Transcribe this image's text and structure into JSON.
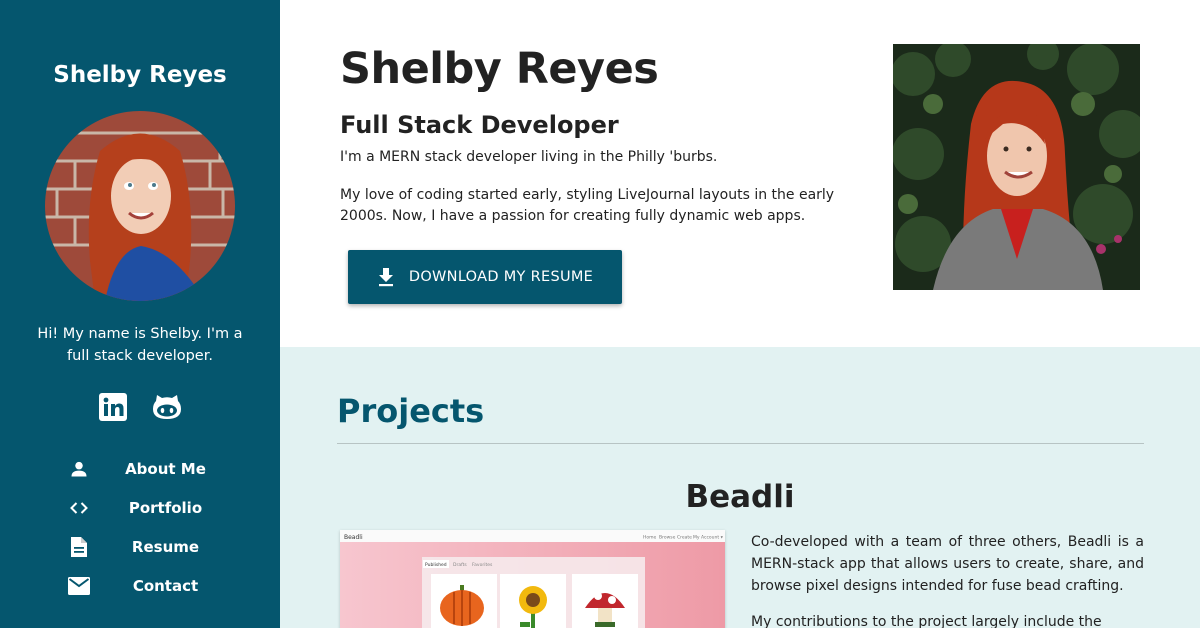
{
  "sidebar": {
    "name": "Shelby Reyes",
    "bio": "Hi! My name is Shelby. I'm a full stack developer.",
    "social": [
      {
        "icon": "linkedin-icon"
      },
      {
        "icon": "github-icon"
      }
    ],
    "nav": [
      {
        "label": "About Me",
        "icon": "person-icon"
      },
      {
        "label": "Portfolio",
        "icon": "code-icon"
      },
      {
        "label": "Resume",
        "icon": "document-icon"
      },
      {
        "label": "Contact",
        "icon": "mail-icon"
      }
    ],
    "bg_color": "#05566e"
  },
  "hero": {
    "name": "Shelby Reyes",
    "role": "Full Stack Developer",
    "p1": "I'm a MERN stack developer living in the Philly 'burbs.",
    "p2": "My love of coding started early, styling LiveJournal layouts in the early 2000s. Now, I have a passion for creating fully dynamic web apps.",
    "button_label": "DOWNLOAD MY RESUME",
    "button_icon": "download-icon"
  },
  "projects": {
    "heading": "Projects",
    "items": [
      {
        "title": "Beadli",
        "screenshot": {
          "brand": "Beadli",
          "nav": [
            "Home",
            "Browse",
            "Create",
            "My Account ▾"
          ],
          "tabs": [
            "Published",
            "Drafts",
            "Favorites"
          ]
        },
        "paragraphs": [
          "Co-developed with a team of three others, Beadli is a MERN-stack app that allows users to create, share, and browse pixel designs intended for fuse bead crafting.",
          "My contributions to the project largely include the"
        ]
      }
    ],
    "bg_color": "#e2f2f2"
  }
}
